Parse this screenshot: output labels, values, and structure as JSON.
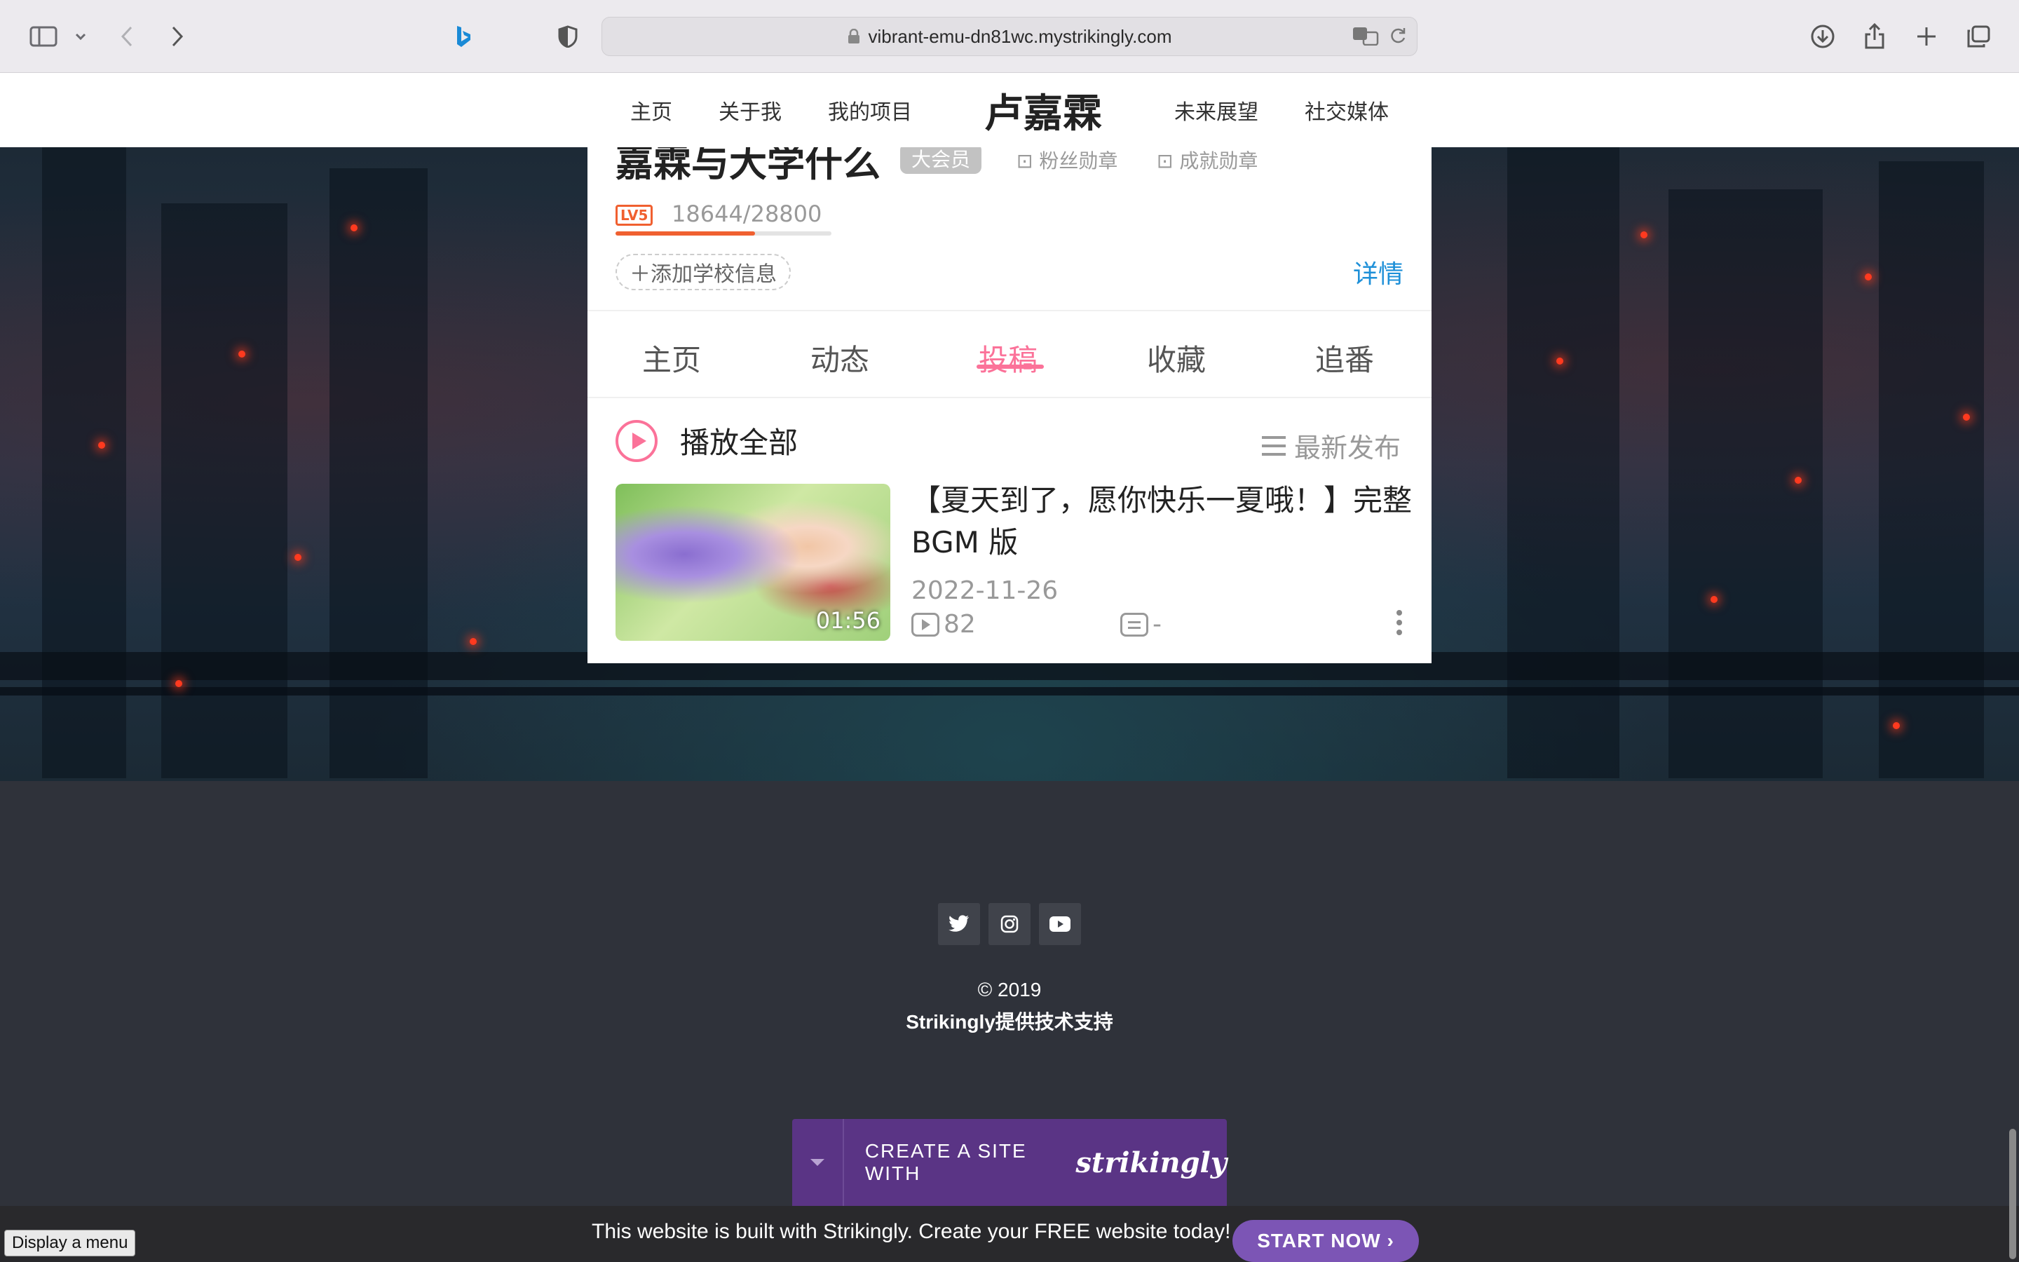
{
  "browser": {
    "url": "vibrant-emu-dn81wc.mystrikingly.com",
    "icons": [
      "sidebar-icon",
      "chevron-down-icon",
      "back-icon",
      "forward-icon",
      "bing-icon",
      "shield-icon",
      "translate-icon",
      "reload-icon",
      "download-icon",
      "share-icon",
      "new-tab-icon",
      "tabs-overview-icon"
    ]
  },
  "site_nav": {
    "items_left": [
      "主页",
      "关于我",
      "我的项目"
    ],
    "title": "卢嘉霖",
    "items_right": [
      "未来展望",
      "社交媒体"
    ]
  },
  "profile_card": {
    "name": "嘉霖与大学什么",
    "vip": "大会员",
    "medal_fans": "粉丝勋章",
    "medal_achieve": "成就勋章",
    "level": "LV5",
    "exp": "18644/28800",
    "exp_progress": 0.647,
    "school": "添加学校信息",
    "detail": "详情",
    "tabs": [
      "主页",
      "动态",
      "投稿",
      "收藏",
      "追番"
    ],
    "active_tab": "投稿",
    "play_all": "播放全部",
    "sort": "最新发布",
    "video": {
      "duration": "01:56",
      "title": "【夏天到了，愿你快乐一夏哦！】完整 BGM 版",
      "date": "2022-11-26",
      "views": "82",
      "danmaku": "-"
    }
  },
  "footer": {
    "social": [
      "twitter-icon",
      "instagram-icon",
      "youtube-icon"
    ],
    "copyright": "© 2019",
    "powered": "Strikingly提供技术支持",
    "create_text": "CREATE A SITE WITH",
    "create_brand": "strikingly"
  },
  "banner": {
    "text": "This website is built with Strikingly.  Create your FREE website today!",
    "button": "START NOW"
  },
  "tooltip": "Display a menu",
  "colors": {
    "accent_pink": "#fb7299",
    "link_blue": "#1e90d8",
    "footer_bg": "#2f323a",
    "strikingly_purple": "#5a3485",
    "start_button": "#7c55b5"
  }
}
